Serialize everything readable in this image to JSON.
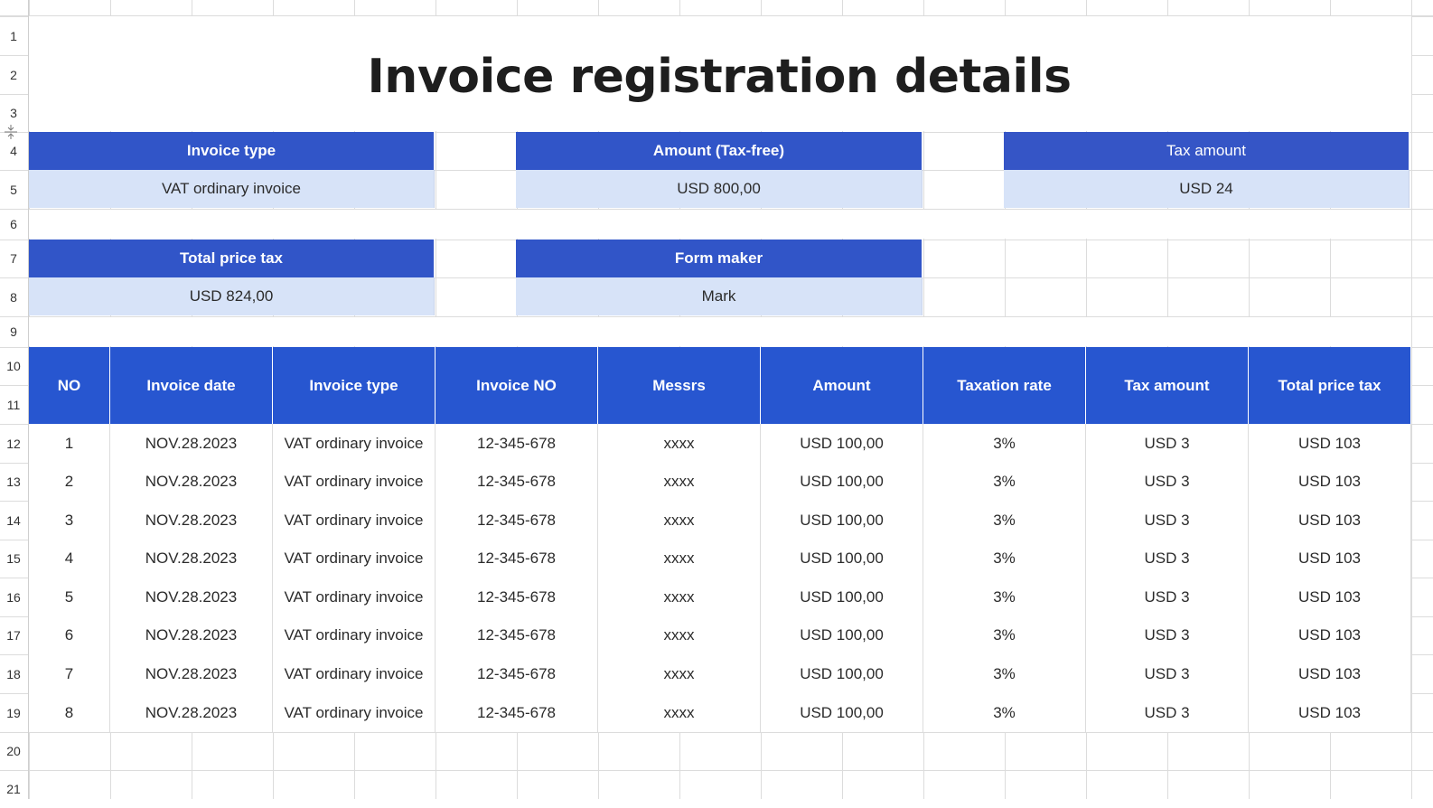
{
  "sheet": {
    "title": "Invoice registration details",
    "row_numbers": [
      "1",
      "2",
      "3",
      "4",
      "5",
      "6",
      "7",
      "8",
      "9",
      "10",
      "11",
      "12",
      "13",
      "14",
      "15",
      "16",
      "17",
      "18",
      "19",
      "20",
      "21"
    ]
  },
  "summary": {
    "invoice_type_label": "Invoice type",
    "invoice_type_value": "VAT ordinary invoice",
    "amount_label": "Amount (Tax-free)",
    "amount_value": "USD 800,00",
    "tax_amount_label": "Tax amount",
    "tax_amount_value": "USD 24",
    "total_price_tax_label": "Total price tax",
    "total_price_tax_value": "USD 824,00",
    "form_maker_label": "Form maker",
    "form_maker_value": "Mark"
  },
  "table": {
    "headers": [
      "NO",
      "Invoice date",
      "Invoice type",
      "Invoice NO",
      "Messrs",
      "Amount",
      "Taxation rate",
      "Tax amount",
      "Total price tax"
    ],
    "rows": [
      [
        "1",
        "NOV.28.2023",
        "VAT ordinary invoice",
        "12-345-678",
        "xxxx",
        "USD 100,00",
        "3%",
        "USD 3",
        "USD 103"
      ],
      [
        "2",
        "NOV.28.2023",
        "VAT ordinary invoice",
        "12-345-678",
        "xxxx",
        "USD 100,00",
        "3%",
        "USD 3",
        "USD 103"
      ],
      [
        "3",
        "NOV.28.2023",
        "VAT ordinary invoice",
        "12-345-678",
        "xxxx",
        "USD 100,00",
        "3%",
        "USD 3",
        "USD 103"
      ],
      [
        "4",
        "NOV.28.2023",
        "VAT ordinary invoice",
        "12-345-678",
        "xxxx",
        "USD 100,00",
        "3%",
        "USD 3",
        "USD 103"
      ],
      [
        "5",
        "NOV.28.2023",
        "VAT ordinary invoice",
        "12-345-678",
        "xxxx",
        "USD 100,00",
        "3%",
        "USD 3",
        "USD 103"
      ],
      [
        "6",
        "NOV.28.2023",
        "VAT ordinary invoice",
        "12-345-678",
        "xxxx",
        "USD 100,00",
        "3%",
        "USD 3",
        "USD 103"
      ],
      [
        "7",
        "NOV.28.2023",
        "VAT ordinary invoice",
        "12-345-678",
        "xxxx",
        "USD 100,00",
        "3%",
        "USD 3",
        "USD 103"
      ],
      [
        "8",
        "NOV.28.2023",
        "VAT ordinary invoice",
        "12-345-678",
        "xxxx",
        "USD 100,00",
        "3%",
        "USD 3",
        "USD 103"
      ]
    ]
  },
  "colors": {
    "summary_header": "#3155c8",
    "summary_value": "#d7e3f8",
    "table_header": "#2756d0",
    "grid": "#dcdcdc"
  },
  "icons": [
    "row-resize-icon"
  ]
}
